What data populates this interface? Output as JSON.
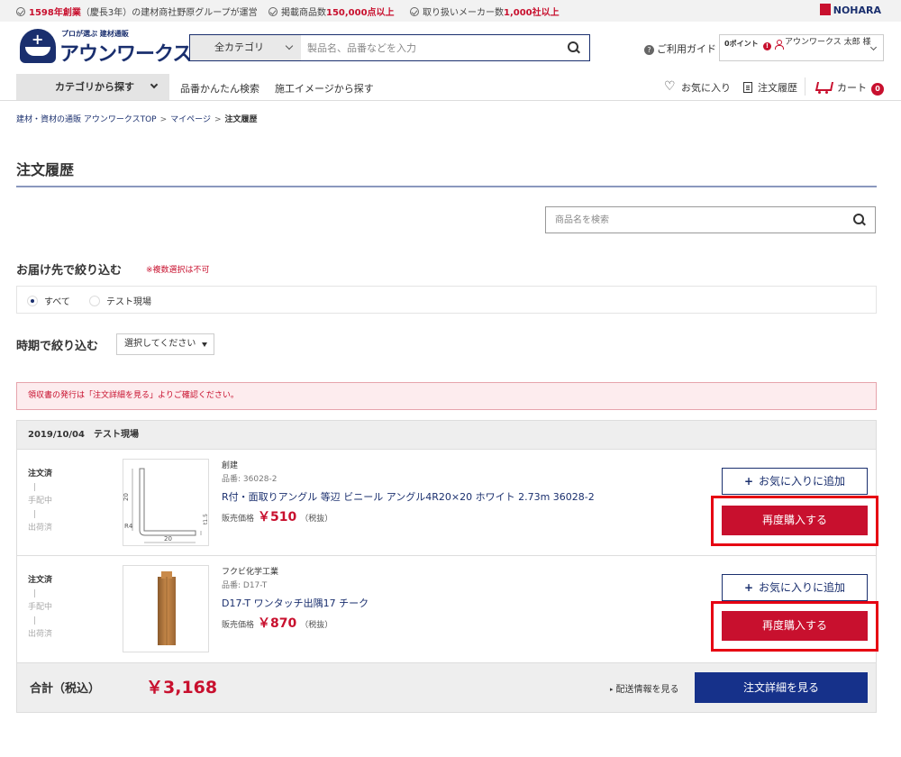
{
  "topbar": {
    "item1_em": "1598年創業",
    "item1_rest": "（慶長3年）の建材商社野原グループが運営",
    "item2_pre": "掲載商品数",
    "item2_em": "150,000点以上",
    "item3_pre": "取り扱いメーカー数",
    "item3_em": "1,000社以上",
    "brand": "NOHARA"
  },
  "header": {
    "logo_tag": "プロが選ぶ 建材通販",
    "logo_name": "アウンワークス",
    "search_category": "全カテゴリ",
    "search_placeholder": "製品名、品番などを入力",
    "guide": "ご利用ガイド",
    "points": "0ポイント",
    "user_name": "アウンワークス 太郎 様"
  },
  "nav": {
    "category_button": "カテゴリから探す",
    "link1": "品番かんたん検索",
    "link2": "施工イメージから探す",
    "favorites": "お気に入り",
    "history": "注文履歴",
    "cart": "カート",
    "cart_count": "0"
  },
  "breadcrumb": {
    "top": "建材・資材の通販 アウンワークスTOP",
    "mypage": "マイページ",
    "current": "注文履歴"
  },
  "page": {
    "title": "注文履歴",
    "search_placeholder": "商品名を検索",
    "filter_dest_title": "お届け先で絞り込む",
    "filter_dest_note": "※複数選択は不可",
    "radio_all": "すべて",
    "radio_site": "テスト現場",
    "filter_period_title": "時期で絞り込む",
    "period_select": "選択してください",
    "notice": "領収書の発行は「注文詳細を見る」よりご確認ください。"
  },
  "order": {
    "date": "2019/10/04",
    "site": "テスト現場",
    "status": [
      "注文済",
      "手配中",
      "出荷済"
    ],
    "bar": "|",
    "items": [
      {
        "maker": "創建",
        "code": "品番: 36028-2",
        "name": "R付・面取りアングル 等辺 ビニール アングル4R20×20 ホワイト 2.73m 36028-2",
        "price_label": "販売価格",
        "price": "￥510",
        "tax": "（税抜）"
      },
      {
        "maker": "フクビ化学工業",
        "code": "品番: D17-T",
        "name": "D17-T ワンタッチ出隅17 チーク",
        "price_label": "販売価格",
        "price": "￥870",
        "tax": "（税抜）"
      }
    ],
    "fav_button": "お気に入りに追加",
    "buy_button": "再度購入する",
    "total_label": "合計（税込）",
    "total_value": "￥3,168",
    "shipping_link": "配送情報を見る",
    "detail_button": "注文詳細を見る"
  },
  "diagram1": {
    "dim_h": "20",
    "dim_w": "20",
    "dim_r": "R4",
    "dim_t": "t1.5"
  },
  "colors": {
    "navy": "#1a2f6e",
    "red": "#c8102e",
    "highlight": "#e60012"
  }
}
